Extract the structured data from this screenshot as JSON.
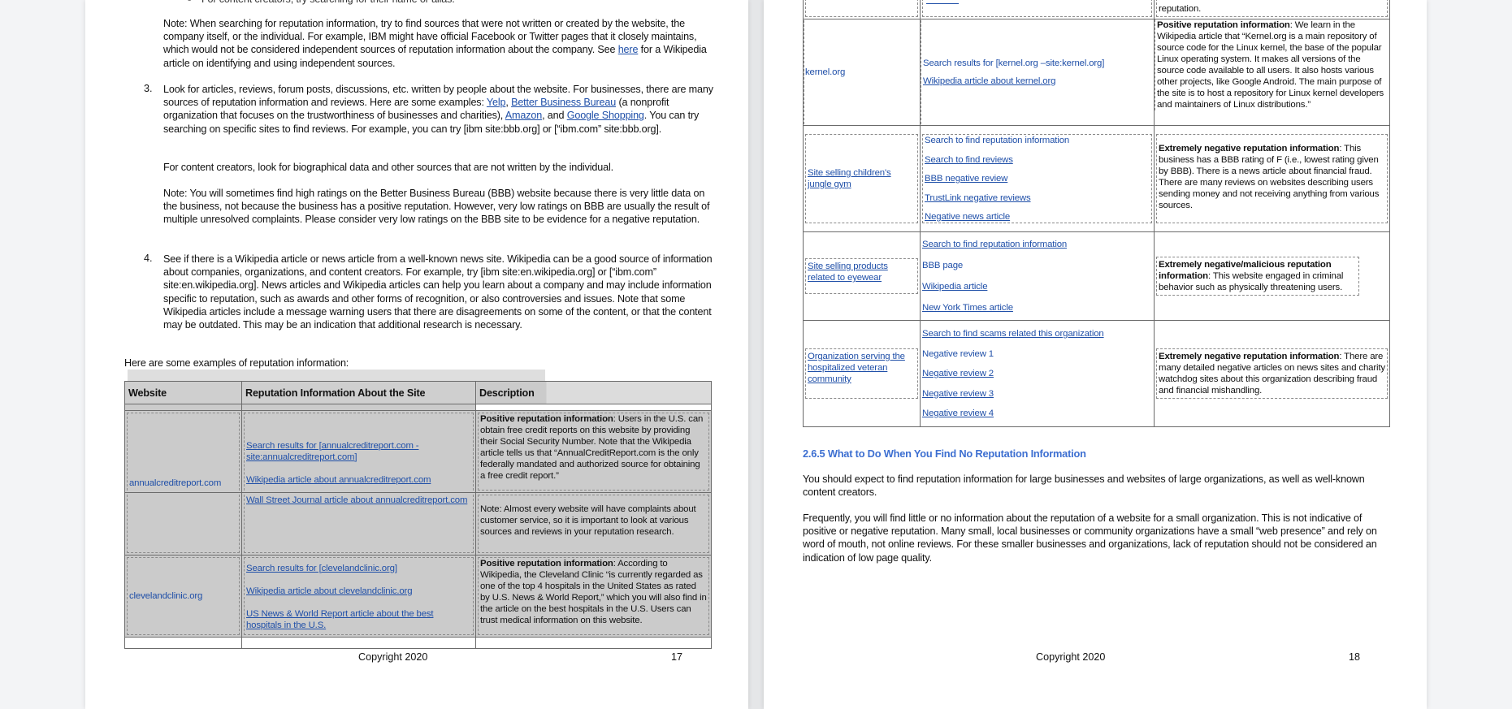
{
  "left_page": {
    "partial_bullet": "For content creators, try searching for their name or alias.",
    "note1": {
      "before": "Note: When searching for reputation information, try to find sources that were not written or created by the website, the company itself, or the individual.  For example, IBM might have official Facebook or Twitter pages that it closely maintains, which would not be considered independent sources of reputation information about the company.  See ",
      "link": "here",
      "after": " for a Wikipedia article on identifying and using independent sources."
    },
    "item3": {
      "number": "3.",
      "text_a": "Look for articles, reviews, forum posts, discussions, etc. written by people about the website.  For businesses, there are many sources of reputation information and reviews.  Here are some examples: ",
      "link_yelp": "Yelp",
      "sep1": ", ",
      "link_bbb": "Better Business Bureau",
      "text_b": " (a nonprofit organization that focuses on the trustworthiness of businesses and charities), ",
      "link_amazon": "Amazon",
      "text_c": ", and ",
      "link_google": "Google Shopping",
      "text_d": ".  You can try searching on specific sites to find reviews.  For example, you can try [ibm site:bbb.org] or [“ibm.com” site:bbb.org].",
      "creators": "For content creators, look for biographical data and other sources that are not written by the individual.",
      "note": "Note: You will sometimes find high ratings on the Better Business Bureau (BBB) website because there is very little data on the business, not because the business has a positive reputation.  However, very low ratings on BBB are usually the result of multiple unresolved complaints.  Please consider very low ratings on the BBB site to be evidence for a negative reputation."
    },
    "item4": {
      "number": "4.",
      "text": "See if there is a Wikipedia article or news article from a well-known news site.  Wikipedia can be a good source of information about companies, organizations, and content creators.  For example, try [ibm site:en.wikipedia.org] or [“ibm.com” site:en.wikipedia.org].  News articles and Wikipedia articles can help you learn about a company and may include information specific to reputation, such as awards and other forms of recognition, or also controversies and issues.  Note that some Wikipedia articles include a message warning users that there are disagreements on some of the content, or that the content may be outdated.  This may be an indication that additional research is necessary."
    },
    "examples_intro": "Here are some examples of reputation information:",
    "table": {
      "headers": [
        "Website",
        "Reputation Information About the Site",
        "Description"
      ],
      "rows": [
        {
          "website": "annualcreditreport.com",
          "links": [
            "Search results for [annualcreditreport.com -site:annualcreditreport.com]",
            "Wikipedia article about annualcreditreport.com"
          ],
          "desc_label": "Positive reputation information",
          "desc_text": ": Users in the U.S. can obtain free credit reports on this website by providing their Social Security Number.  Note that the Wikipedia article tells us that “AnnualCreditReport.com is the only federally mandated and authorized source for obtaining a free credit report.”"
        },
        {
          "website": "",
          "links": [
            "Wall Street Journal article about annualcreditreport.com"
          ],
          "desc_label": "",
          "desc_text": "Note: Almost every website will have complaints about customer service, so it is important to look at various sources and reviews in your reputation research."
        },
        {
          "website": "clevelandclinic.org",
          "links": [
            "Search results for [clevelandclinic.org]",
            "Wikipedia article about clevelandclinic.org",
            "US News & World Report article about the best hospitals in the U.S."
          ],
          "desc_label": "Positive reputation information",
          "desc_text": ": According to Wikipedia, the Cleveland Clinic “is currently regarded as one of the top 4 hospitals in the United States as rated by U.S. News & World Report,” which you will also find in the article on the best hospitals in the U.S.  Users can trust medical information on this website."
        }
      ]
    },
    "footer": {
      "copyright": "Copyright 2020",
      "page_number": "17"
    }
  },
  "right_page": {
    "top_partial_desc": "reputation.",
    "table": {
      "rows": [
        {
          "website": "kernel.org",
          "links": [
            "Search results for [kernel.org –site:kernel.org]",
            "Wikipedia article about kernel.org"
          ],
          "desc_label": "Positive reputation information",
          "desc_text": ": We learn in the Wikipedia article that “Kernel.org is a main repository of source code for the Linux kernel, the base of the popular Linux operating system.  It makes all versions of the source code available to all users.  It also hosts various other projects, like Google Android.  The main purpose of the site is to host a repository for Linux kernel developers and maintainers of Linux distributions.”"
        },
        {
          "website": "Site selling children's jungle gym",
          "links": [
            "Search to find reputation information",
            "Search to find reviews",
            "BBB negative review",
            "TrustLink negative reviews",
            "Negative news article"
          ],
          "desc_label": "Extremely negative reputation information",
          "desc_text": ": This business has a BBB rating of F (i.e., lowest rating given by BBB).  There is a news article about financial fraud.  There are many reviews on websites describing users sending money and not receiving anything from various sources."
        },
        {
          "website": "Site selling products related to eyewear",
          "links": [
            "Search to find reputation information",
            "BBB page",
            "Wikipedia article",
            "New York Times article"
          ],
          "desc_label": "Extremely negative/malicious reputation information",
          "desc_text": ": This website engaged in criminal behavior such as physically threatening users."
        },
        {
          "website": "Organization serving the hospitalized veteran community",
          "links": [
            "Search to find scams related this organization",
            "Negative review 1",
            "Negative review 2",
            "Negative review 3",
            "Negative review 4"
          ],
          "desc_label": "Extremely negative reputation information",
          "desc_text": ": There are many detailed negative articles on news sites and charity watchdog sites about this organization describing fraud and financial mishandling."
        }
      ]
    },
    "section_title": "2.6.5 What to Do When You Find No Reputation Information",
    "para1": "You should expect to find reputation information for large businesses and websites of large organizations, as well as well-known content creators.",
    "para2": "Frequently, you will find little or no information about the reputation of a website for a small organization.  This is not indicative of positive or negative reputation.  Many small, local businesses or community organizations have a small “web presence” and rely on word of mouth, not online reviews.  For these smaller businesses and organizations, lack of reputation should not be considered an indication of low page quality.",
    "footer": {
      "copyright": "Copyright 2020",
      "page_number": "18"
    }
  },
  "colors": {
    "link": "#1f4fa8",
    "heading": "#3d6fd1",
    "selection": "#cbcbcb"
  }
}
